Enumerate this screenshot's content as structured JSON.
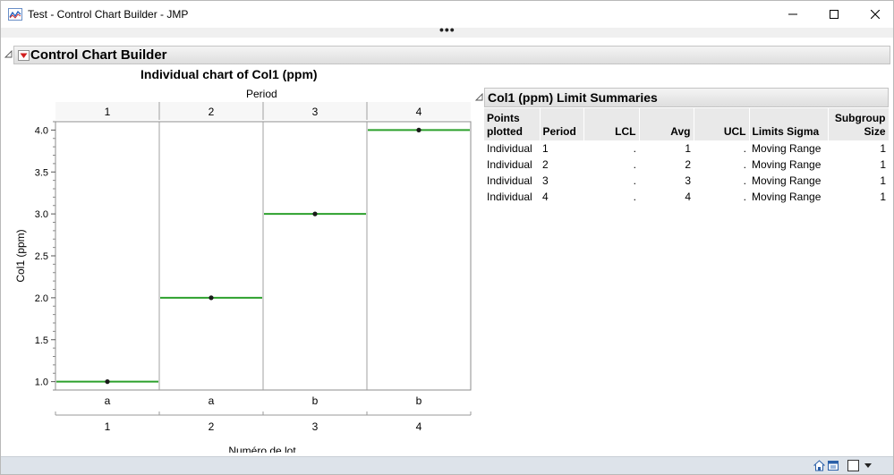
{
  "window": {
    "title": "Test - Control Chart Builder - JMP"
  },
  "grip": {
    "dots": "•••"
  },
  "report": {
    "outline_title": "Control Chart Builder"
  },
  "chart_data": {
    "type": "line",
    "title": "Individual chart of Col1  (ppm)",
    "phase_label": "Period",
    "phases": [
      "1",
      "2",
      "3",
      "4"
    ],
    "ylabel": "Col1  (ppm)",
    "xlabel": "Numéro de lot",
    "ylim": [
      0.9,
      4.1
    ],
    "y_ticks": [
      1.0,
      1.5,
      2.0,
      2.5,
      3.0,
      3.5,
      4.0
    ],
    "y_tick_labels": [
      "1.0",
      "1.5",
      "2.0",
      "2.5",
      "3.0",
      "3.5",
      "4.0"
    ],
    "x_group_labels": [
      "a",
      "a",
      "b",
      "b"
    ],
    "x_labels": [
      "1",
      "2",
      "3",
      "4"
    ],
    "values": [
      1,
      2,
      3,
      4
    ],
    "center_lines": [
      1,
      2,
      3,
      4
    ],
    "grid": false,
    "colors": {
      "center_line": "#2ca02c",
      "point": "#1a1a1a",
      "divider": "#a0a0a0"
    }
  },
  "limit_summaries": {
    "title": "Col1  (ppm) Limit Summaries",
    "headers": {
      "points_plotted_1": "Points",
      "points_plotted_2": "plotted",
      "period": "Period",
      "lcl": "LCL",
      "avg": "Avg",
      "ucl": "UCL",
      "limits_sigma": "Limits Sigma",
      "subgroup_size_1": "Subgroup",
      "subgroup_size_2": "Size"
    },
    "rows": [
      {
        "points": "Individual",
        "period": "1",
        "lcl": ".",
        "avg": "1",
        "ucl": ".",
        "sigma": "Moving Range",
        "size": "1"
      },
      {
        "points": "Individual",
        "period": "2",
        "lcl": ".",
        "avg": "2",
        "ucl": ".",
        "sigma": "Moving Range",
        "size": "1"
      },
      {
        "points": "Individual",
        "period": "3",
        "lcl": ".",
        "avg": "3",
        "ucl": ".",
        "sigma": "Moving Range",
        "size": "1"
      },
      {
        "points": "Individual",
        "period": "4",
        "lcl": ".",
        "avg": "4",
        "ucl": ".",
        "sigma": "Moving Range",
        "size": "1"
      }
    ]
  },
  "icons": {
    "app": "jmp-chart-icon",
    "minimize": "minimize-icon",
    "maximize": "maximize-icon",
    "close": "close-icon",
    "outline_toggle": "disclosure-triangle-icon",
    "red_menu": "red-triangle-menu-icon",
    "status_home": "home-icon",
    "status_window": "window-list-icon",
    "status_dropdown": "chevron-down-icon"
  }
}
